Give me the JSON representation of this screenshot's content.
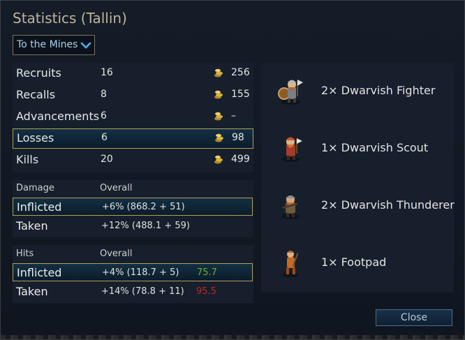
{
  "dialog": {
    "title": "Statistics (Tallin)"
  },
  "scenario_select": {
    "value": "To the Mines",
    "icon": "chevron-down-icon"
  },
  "summary": [
    {
      "label": "Recruits",
      "count": "16",
      "gold": "256",
      "selected": false
    },
    {
      "label": "Recalls",
      "count": "8",
      "gold": "155",
      "selected": false
    },
    {
      "label": "Advancements",
      "count": "6",
      "gold": "–",
      "selected": false
    },
    {
      "label": "Losses",
      "count": "6",
      "gold": "98",
      "selected": true
    },
    {
      "label": "Kills",
      "count": "20",
      "gold": "499",
      "selected": false
    }
  ],
  "damage": {
    "header": "Damage",
    "overall_header": "Overall",
    "rows": [
      {
        "label": "Inflicted",
        "overall": "+6% (868.2 + 51)",
        "extra": "",
        "selected": true
      },
      {
        "label": "Taken",
        "overall": "+12% (488.1 + 59)",
        "extra": "",
        "selected": false
      }
    ]
  },
  "hits": {
    "header": "Hits",
    "overall_header": "Overall",
    "rows": [
      {
        "label": "Inflicted",
        "overall": "+4% (118.7 + 5)",
        "extra": "75.7",
        "extra_color": "#6fae3a",
        "selected": true
      },
      {
        "label": "Taken",
        "overall": "+14% (78.8 + 11)",
        "extra": "95.5",
        "extra_color": "#c0282a",
        "selected": false
      }
    ]
  },
  "units": [
    {
      "label": "2× Dwarvish Fighter",
      "icon": "dwarvish-fighter-icon"
    },
    {
      "label": "1× Dwarvish Scout",
      "icon": "dwarvish-scout-icon"
    },
    {
      "label": "2× Dwarvish Thunderer",
      "icon": "dwarvish-thunderer-icon"
    },
    {
      "label": "1× Footpad",
      "icon": "footpad-icon"
    }
  ],
  "buttons": {
    "close": "Close"
  },
  "colors": {
    "accent_gold": "#b49e5c",
    "title": "#bfb59a",
    "positive": "#6fae3a",
    "negative": "#c0282a"
  }
}
